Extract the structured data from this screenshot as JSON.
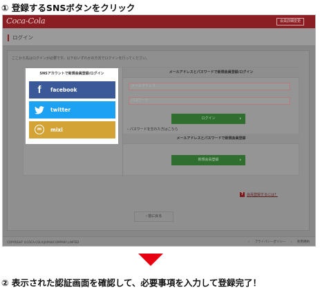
{
  "steps": {
    "step1": "① 登録するSNSボタンをクリック",
    "step2": "② 表示された認証画面を確認して、必要事項を入力して登録完了！"
  },
  "colors": {
    "brand": "#8b1e22",
    "facebook": "#3b5998",
    "twitter": "#1da1f2",
    "mixi": "#d4a336",
    "green_button": "#2f6e2f",
    "arrow": "#e60012"
  },
  "header": {
    "logo": "Coca-Cola",
    "top_link": "会員詳細変更"
  },
  "page": {
    "title": "ログイン",
    "intro": "ここから先はログインが必要です。以下のいずれかの方法でログインを行ってください。"
  },
  "sns": {
    "title": "SNSアカウントで新規会員登録/ログイン",
    "buttons": [
      {
        "label": "facebook",
        "icon": "facebook-icon"
      },
      {
        "label": "twitter",
        "icon": "twitter-bird-icon"
      },
      {
        "label": "mixi",
        "icon": "mixi-icon"
      }
    ]
  },
  "login": {
    "header": "メールアドレスとパスワードで新規会員登録/ログイン",
    "email_placeholder": "メールアドレス",
    "password_placeholder": "パスワード",
    "login_button": "ログイン",
    "forgot": "パスワードを忘れた方はこちら"
  },
  "register": {
    "header": "メールアドレスとパスワードで新規会員登録",
    "button": "新規会員登録"
  },
  "help": {
    "mark": "?",
    "text": "会員登録するには？"
  },
  "back_button": "前に戻る",
  "footer": {
    "copyright": "COPYRIGHT ©COCA-COLA(JAPAN)COMPANY,LIMITED",
    "links": [
      "プライバシーポリシー",
      "利用規約"
    ]
  }
}
